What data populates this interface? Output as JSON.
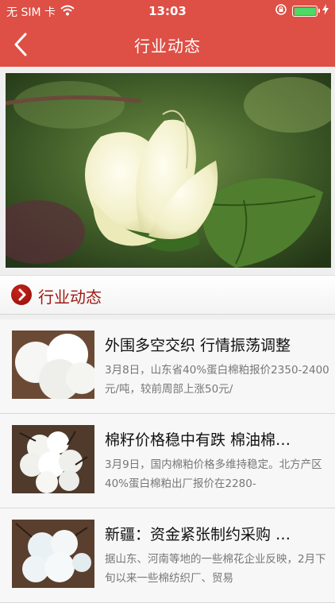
{
  "status_bar": {
    "carrier": "无 SIM 卡",
    "time": "13:03",
    "colors": {
      "battery": "#4cd964"
    }
  },
  "nav": {
    "title": "行业动态",
    "back_icon": "chevron-left-icon",
    "background": "#de4f45"
  },
  "section": {
    "label": "行业动态",
    "icon": "chevron-right-circle-icon",
    "accent": "#a11a12"
  },
  "news": [
    {
      "title": "外围多空交织 行情振荡调整",
      "summary": "3月8日，山东省40%蛋白棉粕报价2350-2400元/吨，较前周部上涨50元/"
    },
    {
      "title": "棉籽价格稳中有跌 棉油棉…",
      "summary": "3月9日，国内棉粕价格多维持稳定。北方产区40%蛋白棉粕出厂报价在2280-"
    },
    {
      "title": "新疆：资金紧张制约采购 …",
      "summary": "据山东、河南等地的一些棉花企业反映，2月下旬以来一些棉纺织厂、贸易"
    }
  ]
}
